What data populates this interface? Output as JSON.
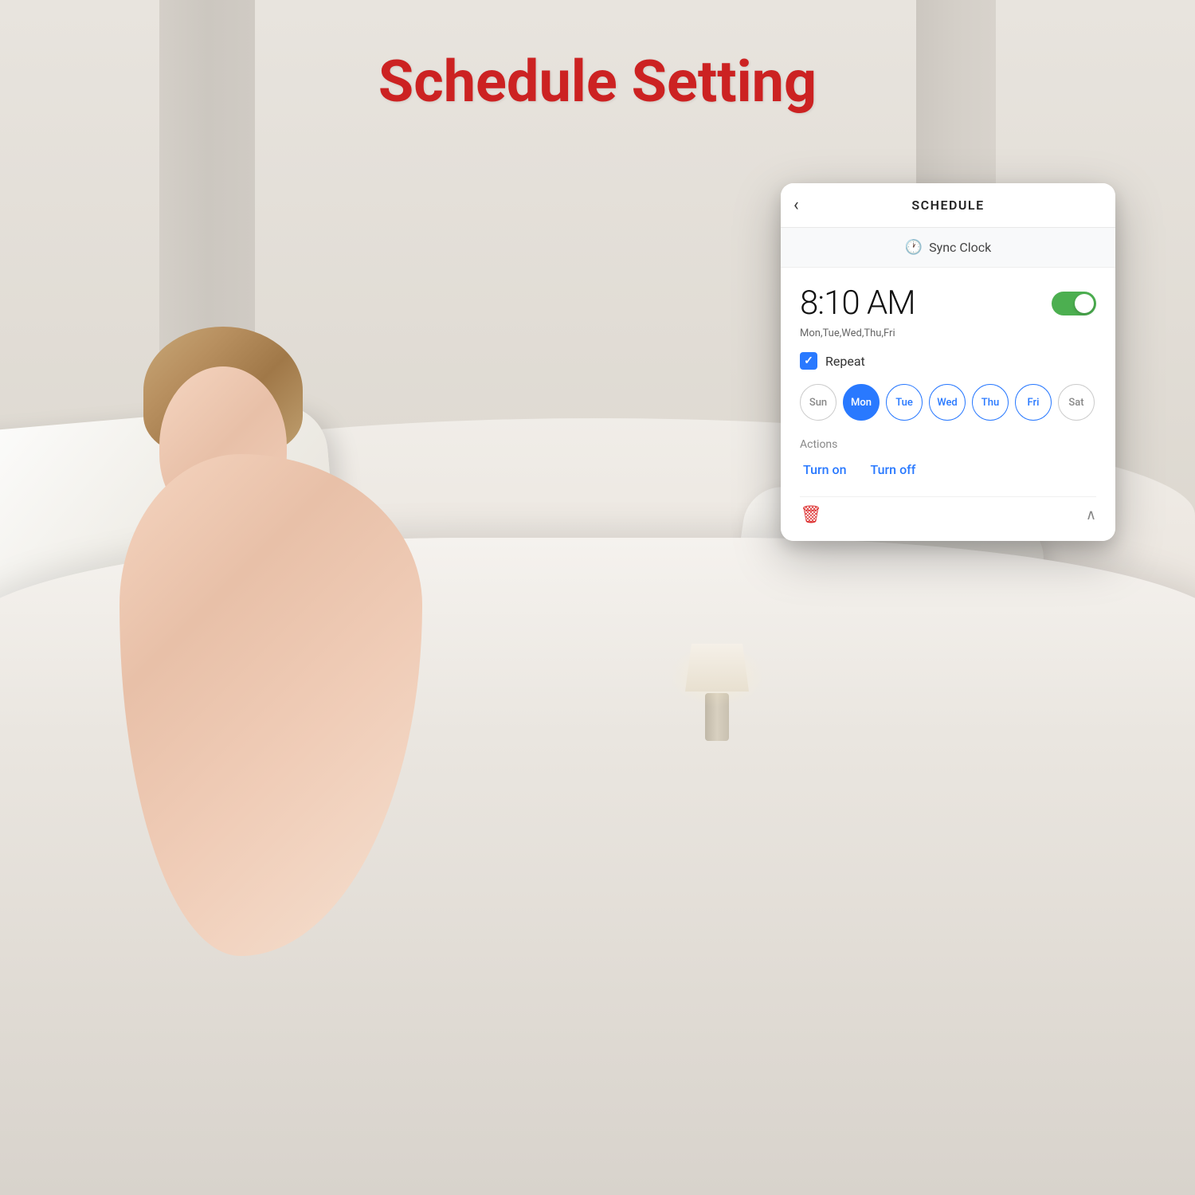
{
  "page": {
    "title": "Schedule Setting",
    "background_description": "Bedroom with sleeping woman on white bedding"
  },
  "app": {
    "header": {
      "back_label": "‹",
      "title": "SCHEDULE"
    },
    "sync_clock": {
      "icon": "🕐",
      "label": "Sync Clock"
    },
    "schedule": {
      "time": "8:10 AM",
      "toggle_state": "on",
      "days_text": "Mon,Tue,Wed,Thu,Fri",
      "repeat_label": "Repeat",
      "days": [
        {
          "key": "sun",
          "label": "Sun",
          "state": "inactive"
        },
        {
          "key": "mon",
          "label": "Mon",
          "state": "active-filled"
        },
        {
          "key": "tue",
          "label": "Tue",
          "state": "active"
        },
        {
          "key": "wed",
          "label": "Wed",
          "state": "active"
        },
        {
          "key": "thu",
          "label": "Thu",
          "state": "active"
        },
        {
          "key": "fri",
          "label": "Fri",
          "state": "active"
        },
        {
          "key": "sat",
          "label": "Sat",
          "state": "inactive"
        }
      ],
      "actions": {
        "label": "Actions",
        "turn_on": "Turn on",
        "turn_off": "Turn off"
      },
      "bottom": {
        "trash_icon": "🗑",
        "chevron_up": "∧"
      }
    }
  }
}
